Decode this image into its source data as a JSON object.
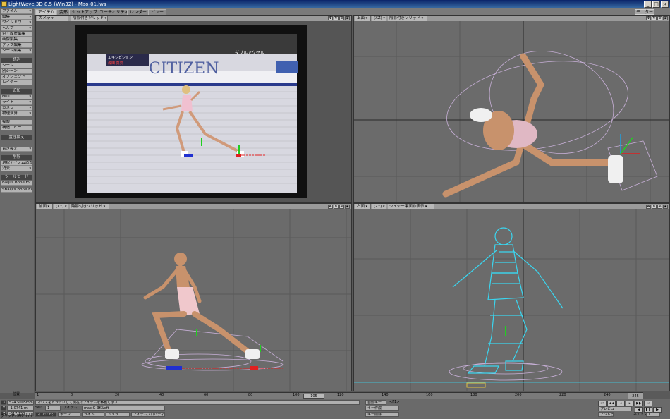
{
  "window": {
    "title": "LightWave 3D 8.5 (Win32) - Mao-01.lws",
    "buttons": [
      "_",
      "□",
      "×"
    ]
  },
  "tabs": [
    "アイテム",
    "変形",
    "セットアップ",
    "ユーティリティ",
    "レンダー",
    "ビュー"
  ],
  "monitor_label": "モニター",
  "toolbar": {
    "items_top": [
      "ファイル",
      "編集",
      "ウインドウ",
      "ヘルプ",
      "色・履歴編集",
      "画像編集",
      "グラフ編集",
      "シーン編集"
    ],
    "sections": [
      {
        "head": "読込",
        "items": [
          "シーン",
          "別シーン",
          "オブジェクト",
          "レイヤー"
        ]
      },
      {
        "head": "追加",
        "items": [
          "Null",
          "ライト",
          "カメラ",
          "物理演算",
          "複製",
          "構造コピー"
        ]
      },
      {
        "head": "置き換え",
        "items": [
          "置き換え"
        ]
      },
      {
        "head": "削除",
        "items": [
          "選択アイテム消去",
          "消去"
        ]
      },
      {
        "head": "",
        "items": [
          "ツールモード",
          "Baiji's Bone Ev",
          "SBaiji's Bone Ev"
        ]
      }
    ]
  },
  "viewports": {
    "top_left": {
      "view": "カメラ",
      "shading": "陰影付きソリッド"
    },
    "top_right": {
      "view": "上面",
      "axis": "(XZ)",
      "shading": "陰影付きソリッド"
    },
    "bottom_left": {
      "view": "前面",
      "axis": "(XY)",
      "shading": "陰影付きソリッド"
    },
    "bottom_right": {
      "view": "右面",
      "axis": "(ZY)",
      "shading": "ワイヤー裏面非表示"
    }
  },
  "camera_overlay": {
    "banner": "CITIZEN",
    "scoreboard_left": "エキシビション",
    "scoreboard_name": "浅田 真央",
    "scoreboard_right": "ダブルアクセル"
  },
  "timeline": {
    "start": "0",
    "labels": [
      "0",
      "20",
      "40",
      "60",
      "80",
      "100",
      "120",
      "140",
      "160",
      "180",
      "200",
      "220",
      "240"
    ],
    "current_frame": "105",
    "end": "245",
    "left_marker": "1"
  },
  "bottom": {
    "position_label": "位置",
    "x_value": "574.5005mm",
    "y_value": "-1.0741 m",
    "z_value": "-317.153 mm",
    "grid_label": "グリッド:",
    "grid_value": "500 mm",
    "status": "マウスをドラッグして現在のアイテムを移動します",
    "sel_label": "Sel:",
    "sel_value": "1",
    "item_label": "アイテム",
    "current_item": "mao:G-3K-Left",
    "mode_buttons": [
      "オブジェクト",
      "ボーン",
      "ライト",
      "カメラ",
      "アイテムプロパティ"
    ],
    "auto_key": "自動キー",
    "auto_key_shortcut": "<F1>",
    "create_key": "キー作成",
    "delete_key": "キー削除",
    "preview": "プレビュー",
    "step_label": "ステップ",
    "step_value": "1",
    "undo": "アンドゥ"
  },
  "colors": {
    "background": "#5a5a5a",
    "viewport_bg": "#6b6b6b",
    "wireframe": "#3ad6f0",
    "body_skin": "#c8926c",
    "leotard": "#f0c8cc",
    "axis_x": "#e02020",
    "axis_y": "#20d020",
    "axis_z": "#2060e0"
  }
}
